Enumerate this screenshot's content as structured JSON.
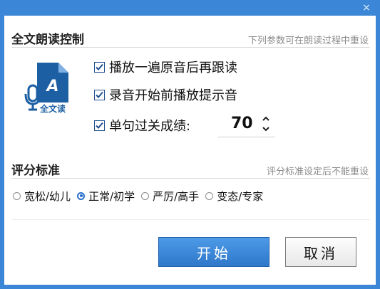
{
  "window": {
    "close_label": "×"
  },
  "section1": {
    "title": "全文朗读控制",
    "hint": "下列参数可在朗读过程中重设",
    "logo_text": "全文读",
    "logo_letter": "A",
    "options": [
      {
        "label": "播放一遍原音后再跟读",
        "checked": true
      },
      {
        "label": "录音开始前播放提示音",
        "checked": true
      },
      {
        "label": "单句过关成绩:",
        "checked": true
      }
    ],
    "pass_score": "70"
  },
  "section2": {
    "title": "评分标准",
    "hint": "评分标准设定后不能重设",
    "options": [
      {
        "label": "宽松/幼儿",
        "selected": false
      },
      {
        "label": "正常/初学",
        "selected": true
      },
      {
        "label": "严厉/高手",
        "selected": false
      },
      {
        "label": "变态/专家",
        "selected": false
      }
    ]
  },
  "buttons": {
    "start": "开始",
    "cancel": "取消"
  },
  "colors": {
    "accent": "#2f77c9",
    "frame": "#3b86d6"
  }
}
